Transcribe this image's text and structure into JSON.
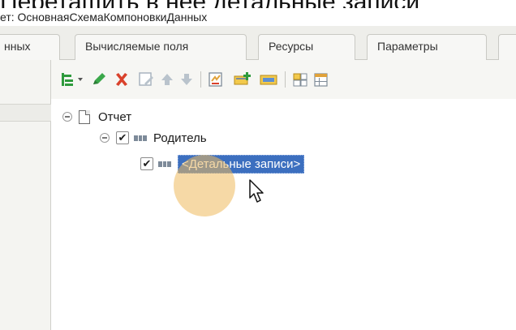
{
  "caption": {
    "text": "Перетащить в нее детальные записи"
  },
  "window": {
    "title": "ет: ОсновнаяСхемаКомпоновкиДанных"
  },
  "tabs": [
    {
      "label": "нных"
    },
    {
      "label": "Вычисляемые поля"
    },
    {
      "label": "Ресурсы"
    },
    {
      "label": "Параметры"
    }
  ],
  "toolbar": {
    "buttons": [
      {
        "icon": "add-dropdown-icon"
      },
      {
        "icon": "edit-pencil-icon"
      },
      {
        "icon": "delete-x-icon"
      },
      {
        "icon": "edit-disabled-icon"
      },
      {
        "icon": "move-up-icon"
      },
      {
        "icon": "move-down-icon"
      },
      {
        "icon": "report-settings-icon"
      },
      {
        "icon": "group-add-icon"
      },
      {
        "icon": "group-view-icon"
      },
      {
        "icon": "table-icon"
      },
      {
        "icon": "table-settings-icon"
      }
    ]
  },
  "tree": {
    "root": {
      "label": "Отчет",
      "icon": "document-icon"
    },
    "group": {
      "label": "Родитель",
      "checked": true,
      "icon": "field-icon"
    },
    "details": {
      "label": "<Детальные записи>",
      "checked": true,
      "selected": true,
      "icon": "field-icon"
    }
  },
  "colors": {
    "selection": "#3c6fbf",
    "cursor_halo": "#eeb95c",
    "accent_green": "#2e9a3c",
    "delete_red": "#d9412b"
  }
}
